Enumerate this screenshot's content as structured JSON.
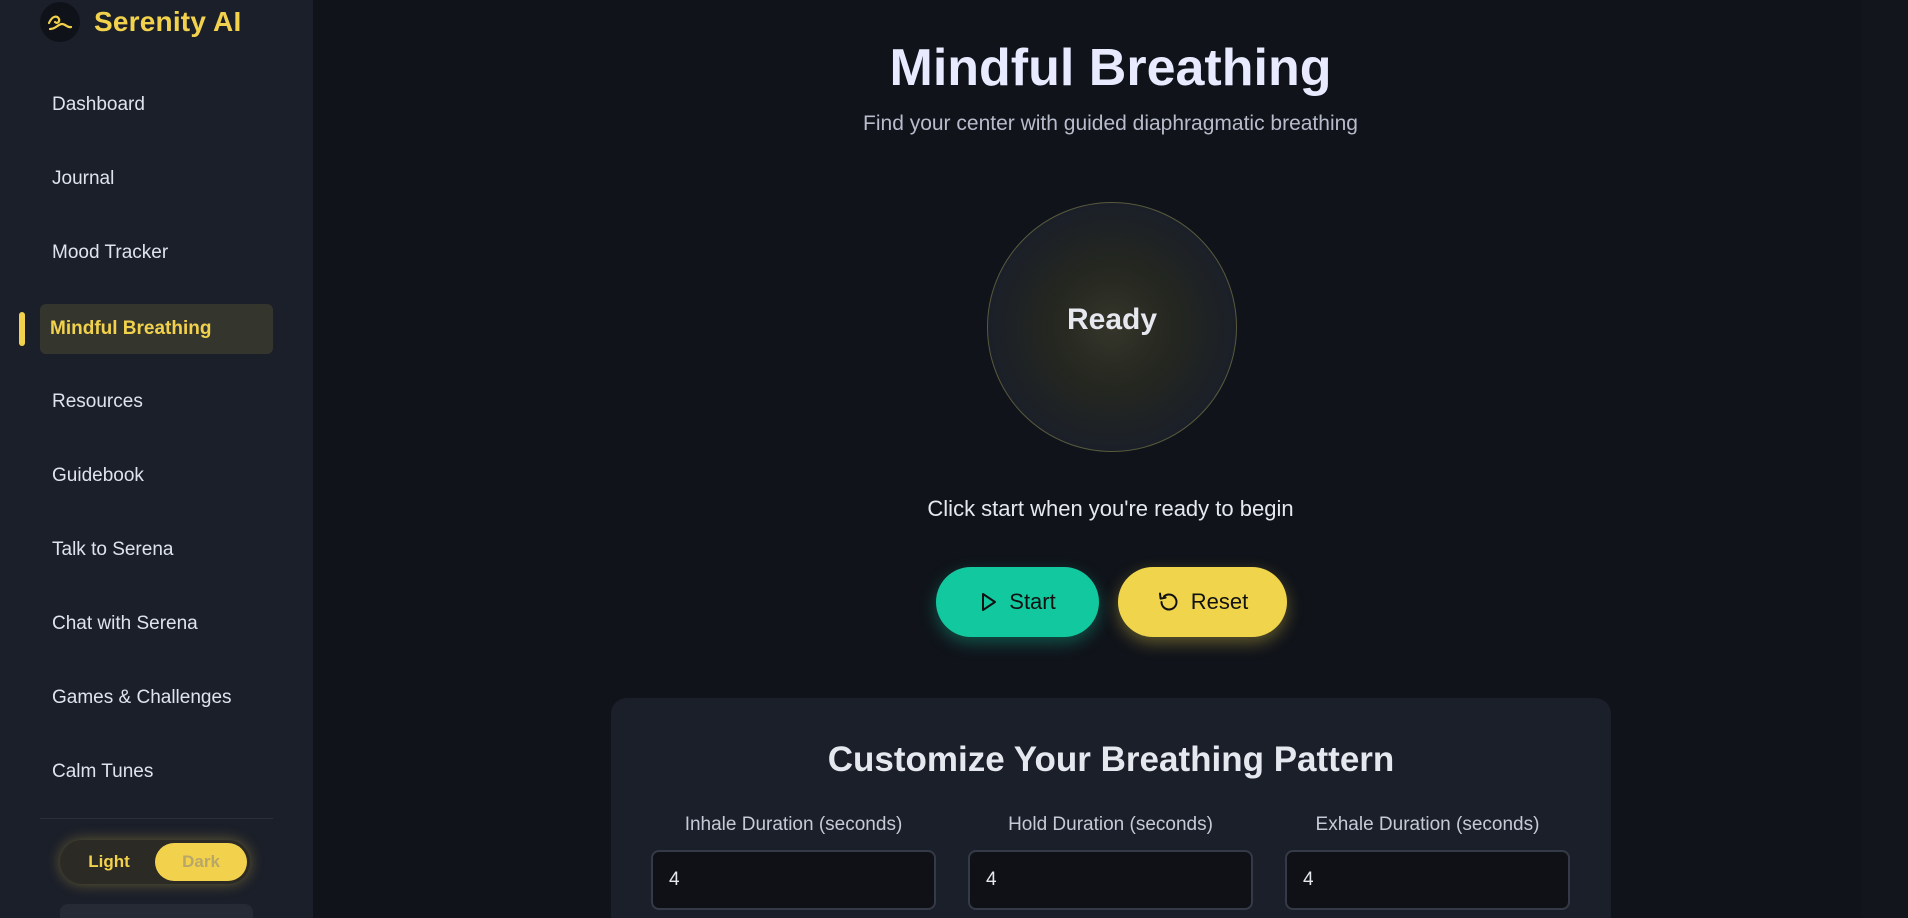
{
  "brand": {
    "name": "Serenity AI"
  },
  "sidebar": {
    "items": [
      {
        "label": "Dashboard"
      },
      {
        "label": "Journal"
      },
      {
        "label": "Mood Tracker"
      },
      {
        "label": "Mindful Breathing",
        "active": true
      },
      {
        "label": "Resources"
      },
      {
        "label": "Guidebook"
      },
      {
        "label": "Talk to Serena"
      },
      {
        "label": "Chat with Serena"
      },
      {
        "label": "Games & Challenges"
      },
      {
        "label": "Calm Tunes"
      }
    ],
    "theme": {
      "light": "Light",
      "dark": "Dark",
      "selected": "Dark"
    }
  },
  "main": {
    "title": "Mindful Breathing",
    "subtitle": "Find your center with guided diaphragmatic breathing",
    "status": "Ready",
    "instruction": "Click start when you're ready to begin",
    "buttons": {
      "start": "Start",
      "reset": "Reset"
    },
    "pattern": {
      "title": "Customize Your Breathing Pattern",
      "fields": [
        {
          "label": "Inhale Duration (seconds)",
          "value": "4"
        },
        {
          "label": "Hold Duration (seconds)",
          "value": "4"
        },
        {
          "label": "Exhale Duration (seconds)",
          "value": "4"
        }
      ]
    }
  },
  "colors": {
    "accent": "#f2d24c",
    "start": "#12c89f",
    "reset": "#f0d54c",
    "background": "#10131a",
    "sidebar": "#1b1f29"
  },
  "icons": {
    "logo": "wave-logo-icon",
    "start": "play-icon",
    "reset": "rotate-ccw-icon"
  }
}
